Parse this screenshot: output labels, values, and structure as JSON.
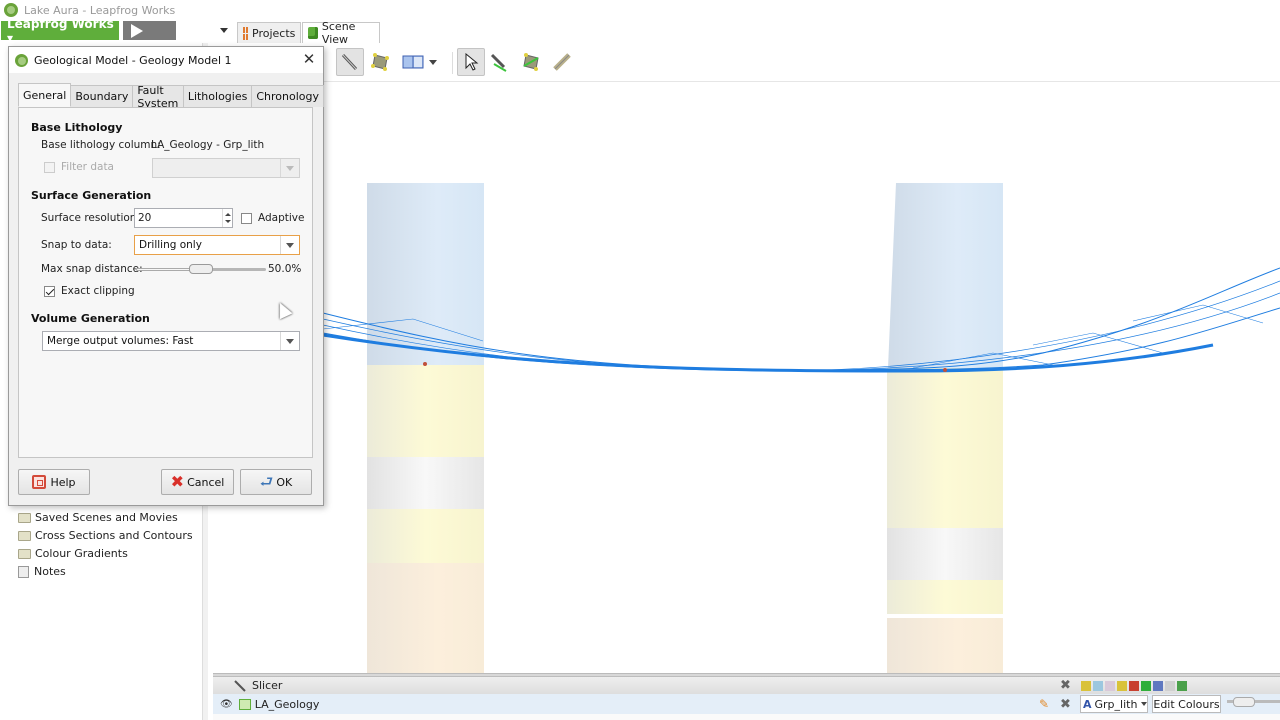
{
  "window": {
    "title": "Lake Aura - Leapfrog Works"
  },
  "menubar": {
    "app_button": "Leapfrog Works ▾",
    "play_button": "play-icon"
  },
  "main_tabs": [
    {
      "label": "Projects",
      "icon": "projects-grid-icon"
    },
    {
      "label": "Scene View",
      "icon": "green-cube-icon",
      "active": true
    }
  ],
  "toolbar": {
    "icons": [
      "slicer-pencil-icon",
      "clip-box-icon",
      "split-view-icon",
      "select-arrow-icon",
      "draw-slicer-icon",
      "section-icon",
      "ruler-icon"
    ]
  },
  "project_tree": {
    "items": [
      {
        "label": "Saved Scenes and Movies",
        "icon": "folder-icon"
      },
      {
        "label": "Cross Sections and Contours",
        "icon": "folder-icon"
      },
      {
        "label": "Colour Gradients",
        "icon": "folder-icon"
      },
      {
        "label": "Notes",
        "icon": "note-icon"
      }
    ]
  },
  "dialog": {
    "title": "Geological Model - Geology Model 1",
    "tabs": [
      {
        "label": "General",
        "active": true
      },
      {
        "label": "Boundary"
      },
      {
        "label": "Fault System"
      },
      {
        "label": "Lithologies"
      },
      {
        "label": "Chronology"
      }
    ],
    "base_lithology": {
      "heading": "Base Lithology",
      "column_label": "Base lithology column:",
      "column_value": "LA_Geology - Grp_lith",
      "filter_label": "Filter data",
      "filter_checked": false,
      "filter_enabled": false,
      "filter_value": ""
    },
    "surface_generation": {
      "heading": "Surface Generation",
      "resolution_label": "Surface resolution:",
      "resolution_value": "20",
      "adaptive_label": "Adaptive",
      "adaptive_checked": false,
      "snap_label": "Snap to data:",
      "snap_value": "Drilling only",
      "max_snap_label": "Max snap distance:",
      "max_snap_value": "50.0%",
      "max_snap_fraction": 0.5,
      "exact_clipping_label": "Exact clipping",
      "exact_clipping_checked": true
    },
    "volume_generation": {
      "heading": "Volume Generation",
      "merge_value": "Merge output volumes: Fast"
    },
    "buttons": {
      "help": "Help",
      "cancel": "Cancel",
      "ok": "OK"
    }
  },
  "shapes_list": {
    "slicer_label": "Slicer",
    "rows": [
      {
        "label": "LA_Geology",
        "visible": true,
        "colour_column": "Grp_lith",
        "edit_colours_label": "Edit Colours"
      }
    ]
  },
  "scene": {
    "surface_colour": "#1f7de0",
    "lithology_colours": [
      "#d6e6f5",
      "#fbf8d2",
      "#ececec",
      "#f8ead8"
    ]
  }
}
